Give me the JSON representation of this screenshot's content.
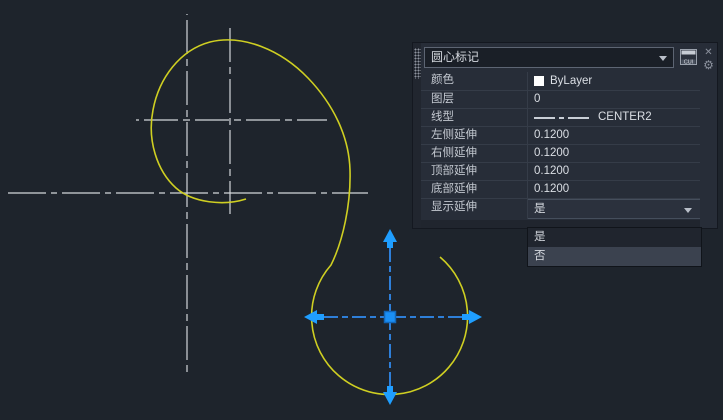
{
  "window": {
    "background": "#1e242c"
  },
  "panel": {
    "title": "圆心标记",
    "cui_button_label": "CUI",
    "icons": {
      "close": "✕",
      "gear": "⚙"
    },
    "rows": [
      {
        "label": "颜色",
        "value": "ByLayer"
      },
      {
        "label": "图层",
        "value": "0"
      },
      {
        "label": "线型",
        "value": "CENTER2"
      },
      {
        "label": "左侧延伸",
        "value": "0.1200"
      },
      {
        "label": "右侧延伸",
        "value": "0.1200"
      },
      {
        "label": "顶部延伸",
        "value": "0.1200"
      },
      {
        "label": "底部延伸",
        "value": "0.1200"
      },
      {
        "label": "显示延伸",
        "value": "是"
      }
    ],
    "dropdown": {
      "options": [
        "是",
        "否"
      ],
      "highlighted": "否"
    }
  },
  "canvas": {
    "spline_color": "#cfcf22",
    "centerline_color": "#d3d6da",
    "grip_line_color": "#2e7fd9",
    "grip_arrow_color": "#1f9eff",
    "grip_square_fill": "#1a8ff5",
    "grip_square_border": "#1266b8"
  }
}
